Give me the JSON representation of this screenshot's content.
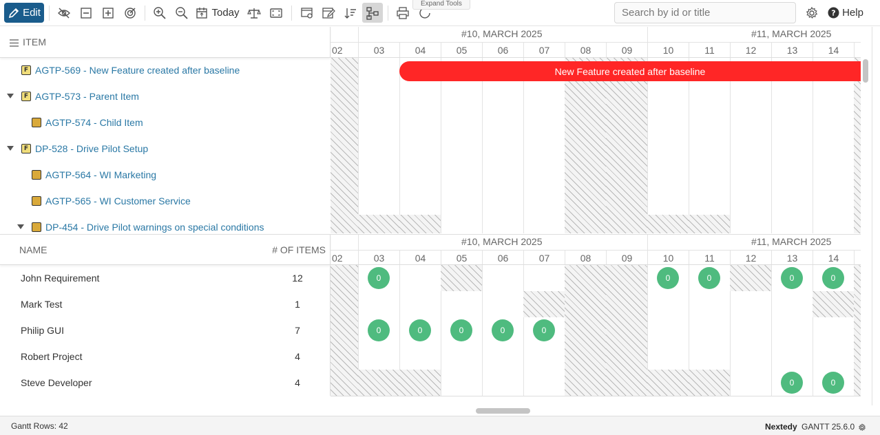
{
  "toolbar": {
    "edit_label": "Edit",
    "today_label": "Today",
    "tooltip": "Expand Tools",
    "search_placeholder": "Search by id or title",
    "help_label": "Help"
  },
  "items_panel": {
    "header": "ITEM",
    "rows": [
      {
        "label": "AGTP-569 - New Feature created after baseline",
        "badge": "F",
        "level": 0,
        "expanded": null
      },
      {
        "label": "AGTP-573 - Parent Item",
        "badge": "F",
        "level": 0,
        "expanded": true
      },
      {
        "label": "AGTP-574 - Child Item",
        "badge": "",
        "level": 1,
        "expanded": null
      },
      {
        "label": "DP-528 - Drive Pilot Setup",
        "badge": "F",
        "level": 0,
        "expanded": true
      },
      {
        "label": "AGTP-564 - WI Marketing",
        "badge": "",
        "level": 1,
        "expanded": null
      },
      {
        "label": "AGTP-565 - WI Customer Service",
        "badge": "",
        "level": 1,
        "expanded": null
      },
      {
        "label": "DP-454 - Drive Pilot warnings on special conditions",
        "badge": "",
        "level": 1,
        "expanded": true
      }
    ]
  },
  "timeline": {
    "weeks": [
      "#10, MARCH 2025",
      "#11, MARCH 2025"
    ],
    "days": [
      "02",
      "03",
      "04",
      "05",
      "06",
      "07",
      "08",
      "09",
      "10",
      "11",
      "12",
      "13",
      "14"
    ]
  },
  "gantt_bar": {
    "label": "New Feature created after baseline",
    "color": "#ff2626"
  },
  "resources_panel": {
    "header_name": "NAME",
    "header_count": "# OF ITEMS",
    "rows": [
      {
        "name": "John Requirement",
        "count": "12"
      },
      {
        "name": "Mark Test",
        "count": "1"
      },
      {
        "name": "Philip GUI",
        "count": "7"
      },
      {
        "name": "Robert Project",
        "count": "4"
      },
      {
        "name": "Steve Developer",
        "count": "4"
      }
    ]
  },
  "workload": {
    "bubble_value": "0",
    "bubble_color": "#4fbb7f",
    "bubbles": [
      {
        "row": 0,
        "day": "03"
      },
      {
        "row": 0,
        "day": "10"
      },
      {
        "row": 0,
        "day": "11"
      },
      {
        "row": 0,
        "day": "13"
      },
      {
        "row": 0,
        "day": "14"
      },
      {
        "row": 2,
        "day": "03"
      },
      {
        "row": 2,
        "day": "04"
      },
      {
        "row": 2,
        "day": "05"
      },
      {
        "row": 2,
        "day": "06"
      },
      {
        "row": 2,
        "day": "07"
      },
      {
        "row": 4,
        "day": "13"
      },
      {
        "row": 4,
        "day": "14"
      }
    ]
  },
  "footer": {
    "rows_count": "Gantt Rows: 42",
    "brand": "Nextedy",
    "version": "GANTT 25.6.0"
  }
}
